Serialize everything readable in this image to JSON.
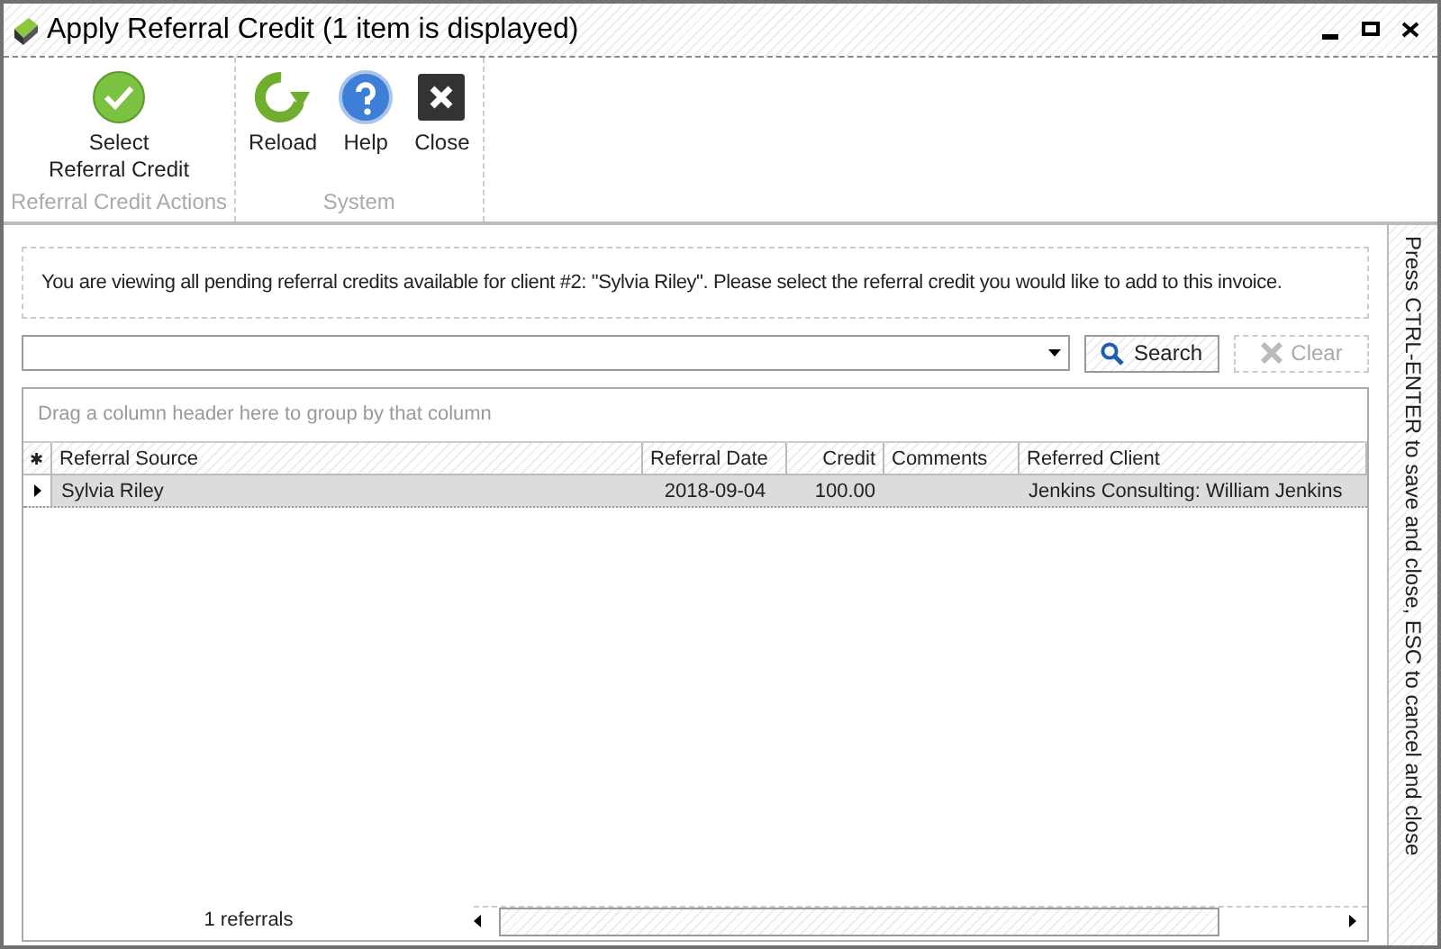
{
  "window": {
    "title": "Apply Referral Credit (1 item is displayed)"
  },
  "ribbon": {
    "groups": [
      {
        "label": "Referral Credit Actions",
        "buttons": [
          {
            "label": "Select\nReferral Credit",
            "kind": "check"
          }
        ]
      },
      {
        "label": "System",
        "buttons": [
          {
            "label": "Reload",
            "kind": "reload"
          },
          {
            "label": "Help",
            "kind": "help"
          },
          {
            "label": "Close",
            "kind": "close"
          }
        ]
      }
    ]
  },
  "info": "You are viewing all pending referral credits available for client #2: \"Sylvia Riley\". Please select the referral credit you would like to add to this invoice.",
  "search": {
    "search_button": "Search",
    "clear_button": "Clear",
    "clear_disabled": true
  },
  "grid": {
    "group_hint": "Drag a column header here to group by that column",
    "new_row_marker": "✱",
    "columns": [
      "Referral Source",
      "Referral Date",
      "Credit",
      "Comments",
      "Referred Client"
    ],
    "rows": [
      {
        "referral_source": "Sylvia Riley",
        "referral_date": "2018-09-04",
        "credit": "100.00",
        "referred_client": "Jenkins Consulting: William Jenkins",
        "selected": true
      }
    ],
    "footer": "1 referrals"
  },
  "side_hint": "Press CTRL-ENTER to save and close, ESC to cancel and close"
}
